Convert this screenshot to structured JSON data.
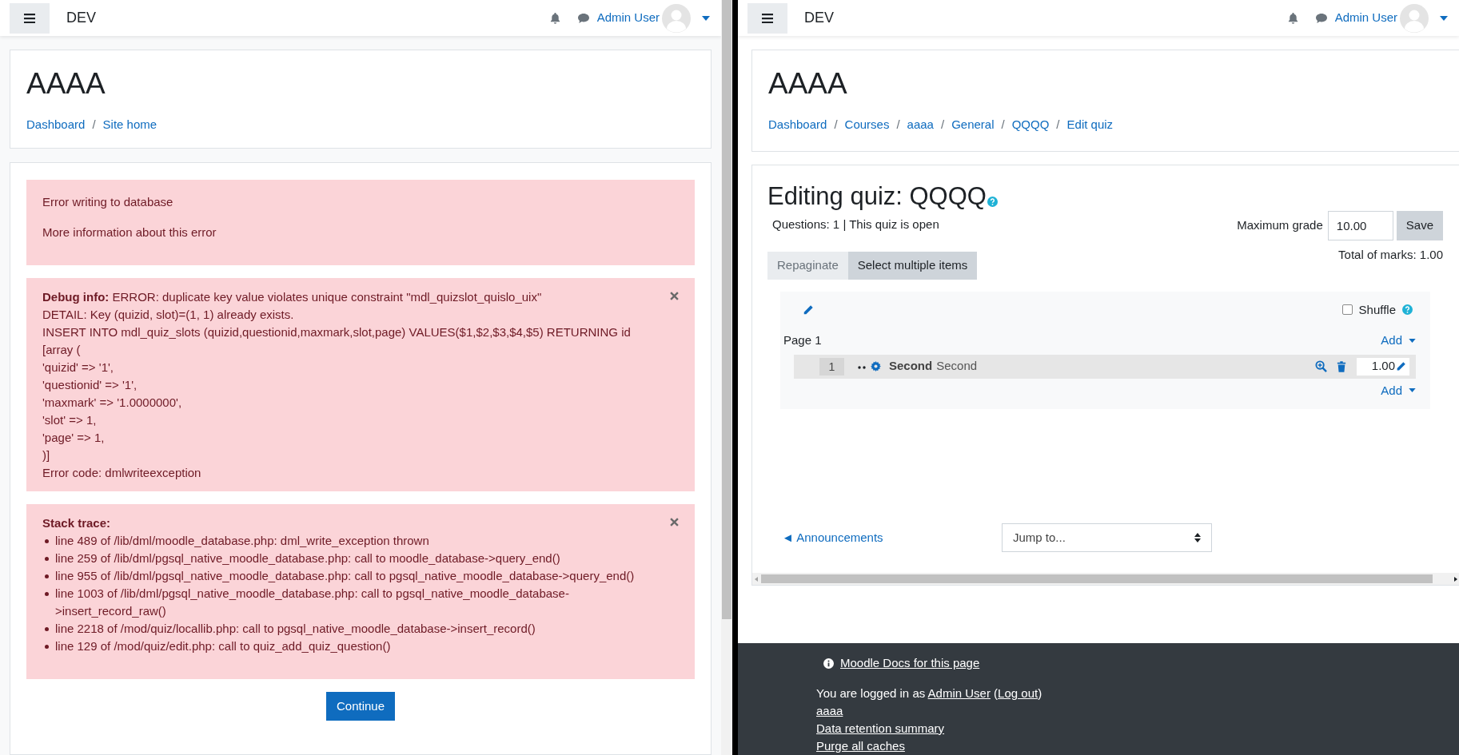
{
  "left_window": {
    "navbar": {
      "brand": "DEV",
      "user": "Admin User"
    },
    "header": {
      "title": "AAAA",
      "separator": "/",
      "breadcrumb": [
        "Dashboard",
        "Site home"
      ]
    },
    "error_alert": {
      "lines": [
        "Error writing to database",
        "More information about this error"
      ]
    },
    "debug_alert": {
      "closable": true,
      "lines": [
        "**Debug info:** ERROR: duplicate key value violates unique constraint \"mdl_quizslot_quislo_uix\"",
        "DETAIL: Key (quizid, slot)=(1, 1) already exists.",
        "INSERT INTO mdl_quiz_slots (quizid,questionid,maxmark,slot,page) VALUES($1,$2,$3,$4,$5) RETURNING id",
        "[array (",
        "'quizid' => '1',",
        "'questionid' => '1',",
        "'maxmark' => '1.0000000',",
        "'slot' => 1,",
        "'page' => 1,",
        ")]",
        "Error code: dmlwriteexception"
      ]
    },
    "stack_alert": {
      "closable": true,
      "title": "Stack trace:",
      "items": [
        "line 489 of /lib/dml/moodle_database.php: dml_write_exception thrown",
        "line 259 of /lib/dml/pgsql_native_moodle_database.php: call to moodle_database->query_end()",
        "line 955 of /lib/dml/pgsql_native_moodle_database.php: call to pgsql_native_moodle_database->query_end()",
        "line 1003 of /lib/dml/pgsql_native_moodle_database.php: call to pgsql_native_moodle_database->insert_record_raw()",
        "line 2218 of /mod/quiz/locallib.php: call to pgsql_native_moodle_database->insert_record()",
        "line 129 of /mod/quiz/edit.php: call to quiz_add_quiz_question()"
      ]
    },
    "continue_button": "Continue"
  },
  "right_window": {
    "navbar": {
      "brand": "DEV",
      "user": "Admin User"
    },
    "header": {
      "title": "AAAA",
      "separator": "/",
      "breadcrumb": [
        "Dashboard",
        "Courses",
        "aaaa",
        "General",
        "QQQQ",
        "Edit quiz"
      ]
    },
    "heading": "Editing quiz: QQQQ",
    "status": "Questions: 1 | This quiz is open",
    "maximum_grade": {
      "label": "Maximum grade",
      "value": "10.00",
      "button": "Save"
    },
    "total_marks": "Total of marks: 1.00",
    "tabs": [
      {
        "label": "Repaginate",
        "disabled": true
      },
      {
        "label": "Select multiple items",
        "disabled": false
      }
    ],
    "shuffle": {
      "label": "Shuffle",
      "checked": false
    },
    "page": {
      "label": "Page 1",
      "add": "Add",
      "questions": [
        {
          "number": "1",
          "name": "Second",
          "text": "Second",
          "mark": "1.00"
        }
      ],
      "add_after": "Add"
    },
    "activity_nav": {
      "previous": "◄ Announcements",
      "jump_placeholder": "Jump to..."
    },
    "footer": {
      "docs_link": "Moodle Docs for this page",
      "login": {
        "prefix": "You are logged in as ",
        "user": "Admin User",
        "open": " (",
        "logout": "Log out",
        "close": ")"
      },
      "links": [
        "aaaa",
        "Data retention summary",
        "Purge all caches"
      ]
    }
  }
}
